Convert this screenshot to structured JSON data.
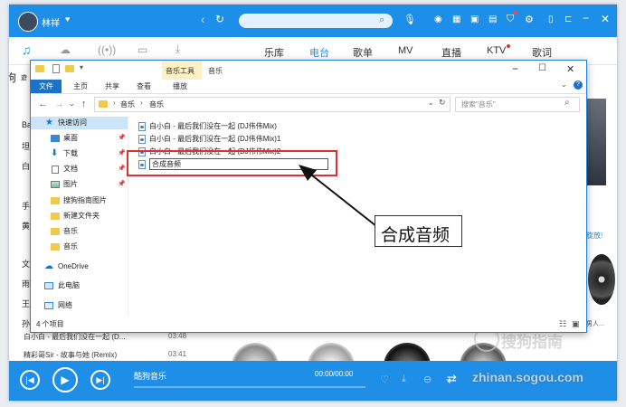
{
  "music_app": {
    "user_name": "林祥",
    "search_placeholder": "",
    "nav_tabs": [
      {
        "label": "乐库",
        "active": false
      },
      {
        "label": "电台",
        "active": true
      },
      {
        "label": "歌单",
        "active": false
      },
      {
        "label": "MV",
        "active": false
      },
      {
        "label": "直播",
        "active": false
      },
      {
        "label": "KTV",
        "active": false
      },
      {
        "label": "歌词",
        "active": false
      }
    ],
    "left_strip_texts": [
      "狗",
      "遊",
      "Ba",
      "坦",
      "白",
      "手",
      "黄",
      "文",
      "雨",
      "王",
      "孙"
    ],
    "playlist": [
      {
        "title": "白小白 - 最后我们没在一起 (D...",
        "time": "03:48"
      },
      {
        "title": "精彩哥Sir - 故事与她 (Remix)",
        "time": "03:41"
      }
    ],
    "right_badge": "旋放!",
    "right_caption": "男人...",
    "player": {
      "title": "酷狗音乐",
      "time": "00:00/00:00"
    },
    "watermark": "搜狗指南",
    "watermark_url": "zhinan.sogou.com",
    "accent_color": "#1e8fe8"
  },
  "explorer": {
    "contextual_tab_label": "音乐工具",
    "window_title": "音乐",
    "ribbon_tabs": [
      {
        "label": "文件",
        "active": true
      },
      {
        "label": "主页",
        "active": false
      },
      {
        "label": "共享",
        "active": false
      },
      {
        "label": "查看",
        "active": false
      },
      {
        "label": "播放",
        "active": false
      }
    ],
    "breadcrumb": [
      "音乐",
      "音乐"
    ],
    "search_placeholder": "搜索\"音乐\"",
    "nav_items": [
      {
        "label": "快速访问",
        "icon": "star-icon",
        "pinned": false
      },
      {
        "label": "桌面",
        "icon": "desktop-icon",
        "pinned": true
      },
      {
        "label": "下载",
        "icon": "download-icon",
        "pinned": true
      },
      {
        "label": "文档",
        "icon": "document-icon",
        "pinned": true
      },
      {
        "label": "图片",
        "icon": "picture-icon",
        "pinned": true
      },
      {
        "label": "搜狗指南图片",
        "icon": "folder-icon",
        "pinned": false
      },
      {
        "label": "新建文件夹",
        "icon": "folder-icon",
        "pinned": false
      },
      {
        "label": "音乐",
        "icon": "folder-icon",
        "pinned": false
      },
      {
        "label": "音乐",
        "icon": "folder-icon",
        "pinned": false
      },
      {
        "label": "OneDrive",
        "icon": "cloud-icon",
        "pinned": false
      },
      {
        "label": "此电脑",
        "icon": "computer-icon",
        "pinned": false
      },
      {
        "label": "网络",
        "icon": "network-icon",
        "pinned": false
      }
    ],
    "files": [
      "白小白 - 最后我们没在一起 (DJ伟伟Mix)",
      "白小白 - 最后我们没在一起 (DJ伟伟Mix)1",
      "白小白 - 最后我们没在一起 (DJ伟伟Mix)2"
    ],
    "renaming_value": "合成音频",
    "status_text": "4 个项目"
  },
  "annotation": {
    "callout_text": "合成音频",
    "highlight_color": "#e0302e"
  }
}
